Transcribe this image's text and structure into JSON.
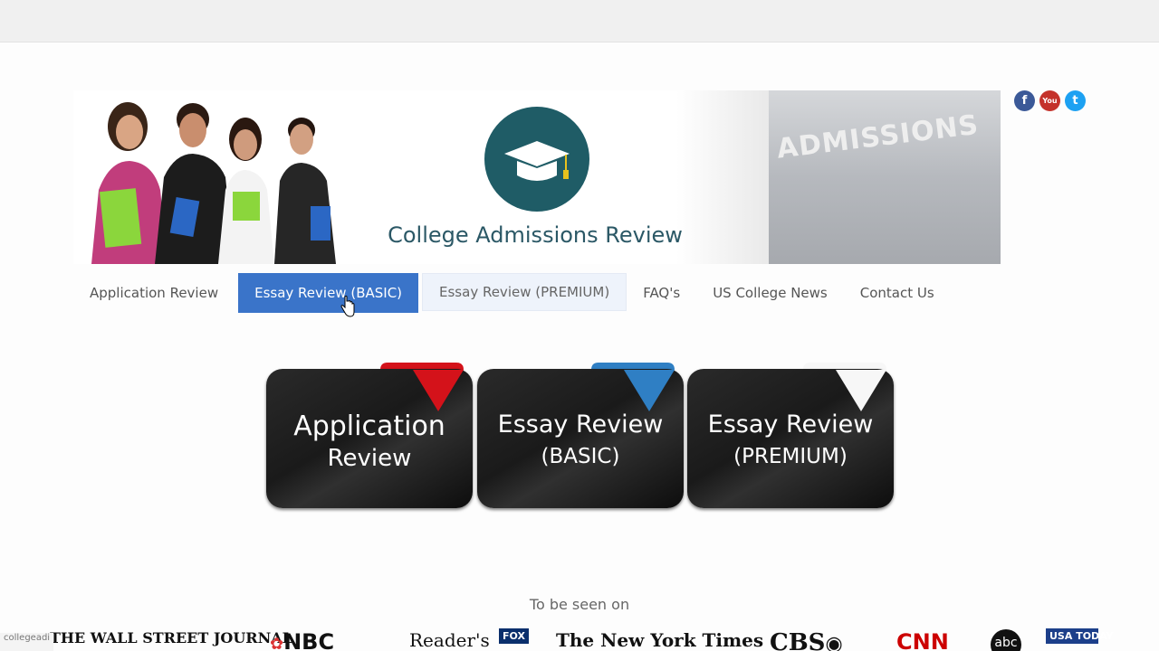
{
  "header": {
    "title": "College Admissions Review",
    "sign_text_small": "ADMISSIONS",
    "sign_text_big": "S"
  },
  "social": {
    "facebook_label": "f",
    "youtube_label": "You",
    "twitter_label": "t"
  },
  "nav": {
    "items": [
      {
        "label": "Application Review"
      },
      {
        "label": "Essay Review (BASIC)"
      },
      {
        "label": "Essay Review (PREMIUM)"
      },
      {
        "label": "FAQ's"
      },
      {
        "label": "US College News"
      },
      {
        "label": "Contact Us"
      }
    ]
  },
  "cards": [
    {
      "line1": "Application",
      "line2": "Review",
      "ribbon_color": "#d4121a"
    },
    {
      "line1": "Essay Review",
      "line2": "(BASIC)",
      "ribbon_color": "#2f7fc4"
    },
    {
      "line1": "Essay Review",
      "line2": "(PREMIUM)",
      "ribbon_color": "#ffffff"
    }
  ],
  "media": {
    "heading": "To be seen on",
    "logos": [
      "THE WALL STREET JOURNAL",
      "NBC",
      "Reader's",
      "FOX",
      "The New York Times",
      "CBS",
      "CNN",
      "abc",
      "USA TODAY"
    ]
  },
  "status": {
    "url_text": "collegeadi"
  }
}
